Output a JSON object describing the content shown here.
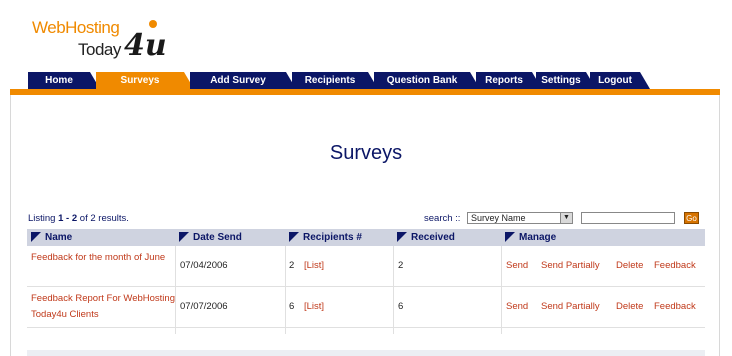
{
  "logo": {
    "line1": "WebHosting",
    "line2": "Today",
    "suffix": "4u"
  },
  "nav": {
    "tabs": [
      {
        "label": "Home",
        "active": false
      },
      {
        "label": "Surveys",
        "active": true
      },
      {
        "label": "Add Survey",
        "active": false
      },
      {
        "label": "Recipients",
        "active": false
      },
      {
        "label": "Question Bank",
        "active": false
      },
      {
        "label": "Reports",
        "active": false
      },
      {
        "label": "Settings",
        "active": false
      },
      {
        "label": "Logout",
        "active": false
      }
    ]
  },
  "page": {
    "title": "Surveys"
  },
  "listing": {
    "prefix": "Listing",
    "from": "1",
    "dash": "-",
    "to": "2",
    "of_text": "of 2 results."
  },
  "search": {
    "label": "search ::",
    "selected": "Survey Name",
    "input_value": "",
    "go_label": "Go"
  },
  "table": {
    "headers": [
      "Name",
      "Date Send",
      "Recipients #",
      "Received",
      "Manage"
    ],
    "rows": [
      {
        "name": "Feedback for the month of June",
        "date": "07/04/2006",
        "recipients": "2",
        "list_label": "[List]",
        "received": "2",
        "actions": [
          "Send",
          "Send Partially",
          "Delete",
          "Feedback"
        ]
      },
      {
        "name": "Feedback Report For WebHostingToday4u Clients",
        "date": "07/07/2006",
        "recipients": "6",
        "list_label": "[List]",
        "received": "6",
        "actions": [
          "Send",
          "Send Partially",
          "Delete",
          "Feedback"
        ]
      }
    ]
  },
  "colors": {
    "navy": "#0b1666",
    "orange": "#f08a00",
    "link": "#c0391a",
    "header_bg": "#cfd3e0"
  }
}
